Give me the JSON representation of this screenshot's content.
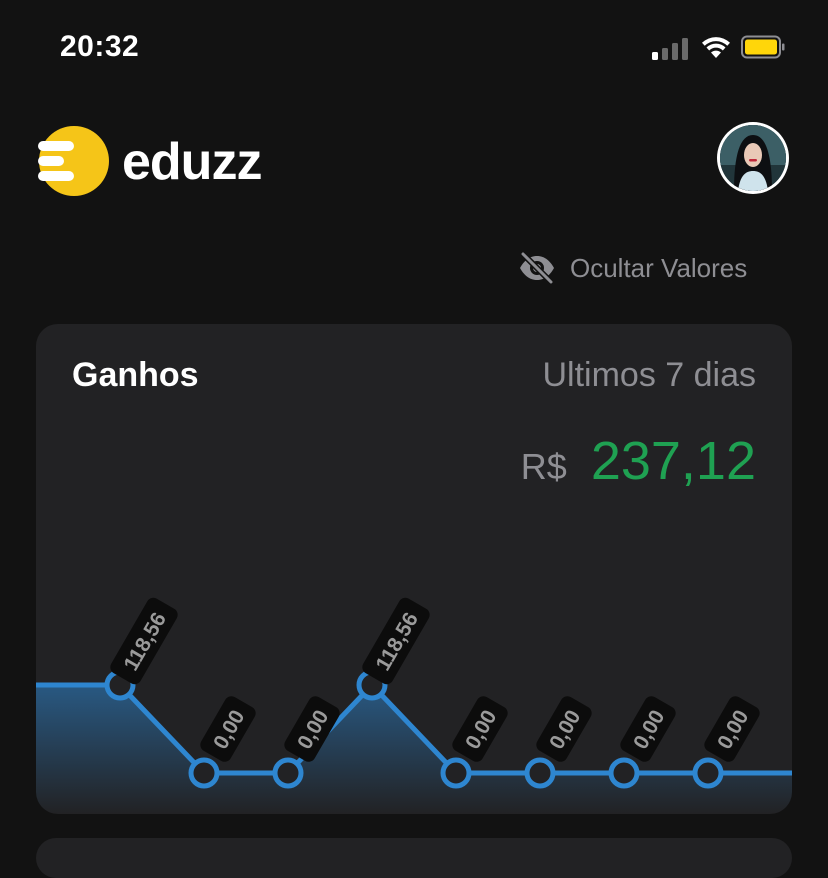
{
  "status_bar": {
    "time": "20:32"
  },
  "brand": {
    "name": "eduzz",
    "logo_color": "#F5C518"
  },
  "hide_values": {
    "label": "Ocultar Valores",
    "icon": "eye-off-icon"
  },
  "earnings_card": {
    "title": "Ganhos",
    "period": "Ultimos 7 dias",
    "currency": "R$",
    "amount": "237,12",
    "amount_color": "#1FA152"
  },
  "chart_data": {
    "type": "area",
    "values": [
      118.56,
      118.56,
      0,
      0,
      118.56,
      0,
      0,
      0,
      0,
      0
    ],
    "labels": [
      null,
      "118,56",
      "0,00",
      "0,00",
      "118,56",
      "0,00",
      "0,00",
      "0,00",
      "0,00",
      null
    ],
    "line_color": "#2E86D0"
  },
  "battery": {
    "color": "#FFD60A"
  }
}
